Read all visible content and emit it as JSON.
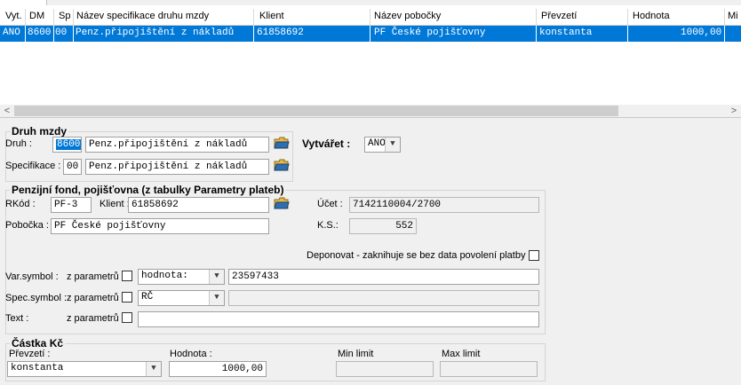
{
  "grid": {
    "headers": [
      "Vyt.",
      "DM",
      "Sp",
      "Název specifikace druhu mzdy",
      "Klient",
      "Název pobočky",
      "Převzetí",
      "Hodnota",
      "Mi"
    ],
    "rows": [
      [
        "ANO",
        "8600",
        "00",
        "Penz.připojištění z nákladů",
        "61858692",
        "PF České pojišťovny",
        "konstanta",
        "1000,00"
      ]
    ],
    "scroll_left": "<",
    "scroll_right": ">"
  },
  "druh_mzdy": {
    "legend": "Druh mzdy",
    "druh_label": "Druh :",
    "druh_code": "8600",
    "druh_name": "Penz.připojištění z nákladů",
    "spec_label": "Specifikace :",
    "spec_code": "00",
    "spec_name": "Penz.připojištění z nákladů"
  },
  "vytvaret": {
    "label": "Vytvářet :",
    "value": "ANO"
  },
  "penzijni": {
    "legend": "Penzijní fond, pojišťovna (z tabulky Parametry plateb)",
    "rkod_label": "RKód :",
    "rkod_value": "PF-3",
    "klient_label": "Klient :",
    "klient_value": "61858692",
    "pobocka_label": "Pobočka :",
    "pobocka_value": "PF České pojišťovny",
    "ucet_label": "Účet :",
    "ucet_value": "7142110004/2700",
    "ks_label": "K.S.:",
    "ks_value": "552",
    "deponovat_label": "Deponovat - zaknihuje se bez data povolení platby :"
  },
  "symbols": {
    "var_label": "Var.symbol :",
    "spec_label": "Spec.symbol :",
    "text_label": "Text :",
    "zparam_label": "z parametrů :",
    "var_combo": "hodnota:",
    "var_value": "23597433",
    "spec_combo": "RČ",
    "spec_value": "",
    "text_value": ""
  },
  "castka": {
    "legend": "Částka Kč",
    "prevzeti_label": "Převzetí :",
    "prevzeti_value": "konstanta",
    "hodnota_label": "Hodnota :",
    "hodnota_value": "1000,00",
    "min_label": "Min limit",
    "max_label": "Max limit",
    "min_value": "",
    "max_value": ""
  }
}
